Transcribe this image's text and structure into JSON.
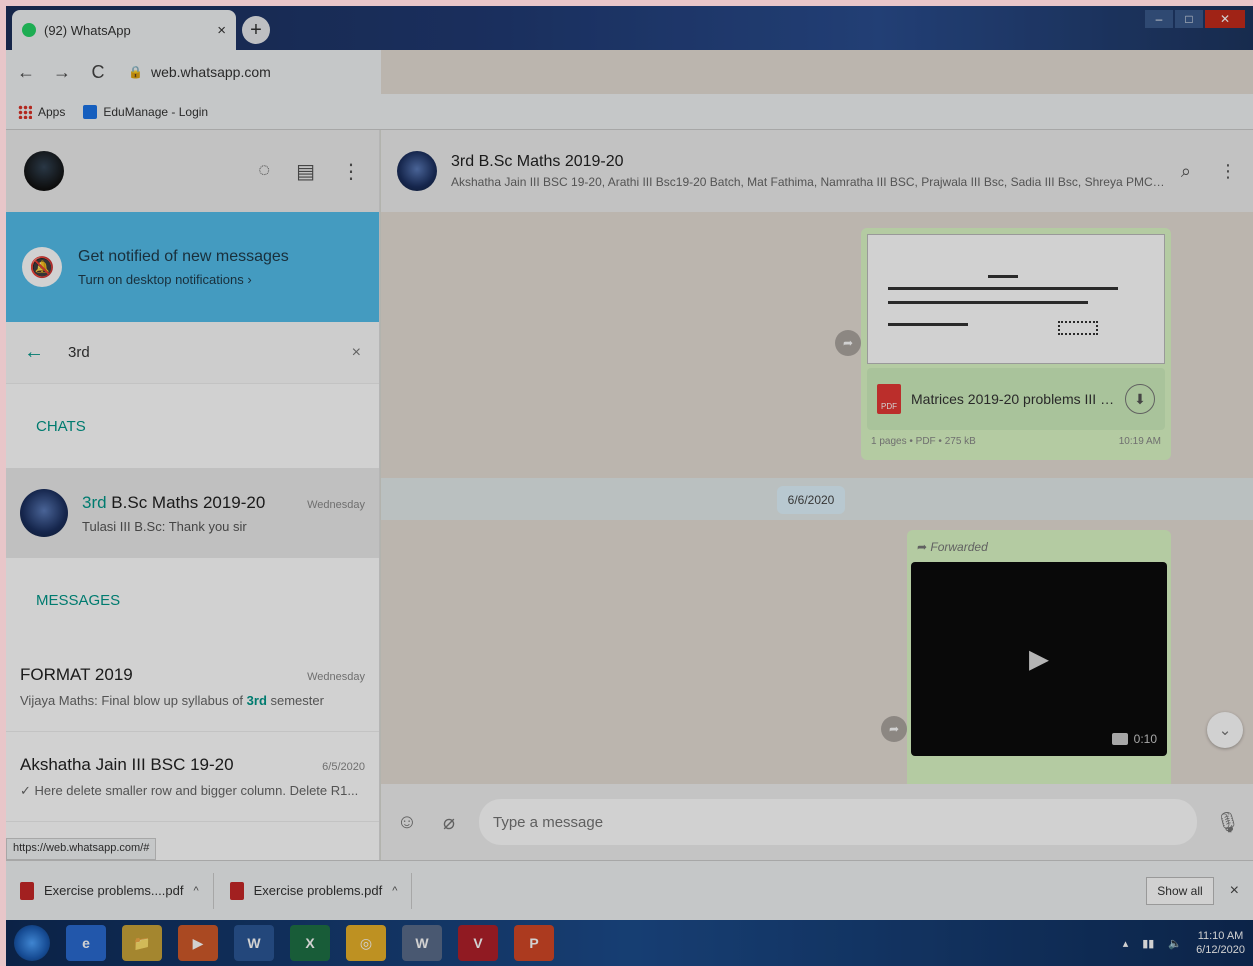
{
  "browser": {
    "tab_title": "(92) WhatsApp",
    "tab_close": "×",
    "new_tab": "+",
    "url": "web.whatsapp.com",
    "nav": {
      "back": "←",
      "forward": "→",
      "reload": "C"
    },
    "star_icon": "☆",
    "menu_icon": "⋮",
    "bookmarks": [
      {
        "label": "Apps"
      },
      {
        "label": "EduManage - Login"
      }
    ],
    "status_url": "https://web.whatsapp.com/#"
  },
  "whatsapp": {
    "left_icons": {
      "status": "◌",
      "new_chat": "▤",
      "menu": "⋮"
    },
    "notification": {
      "title": "Get notified of new messages",
      "subtitle": "Turn on desktop notifications ›"
    },
    "search": {
      "value": "3rd",
      "back": "←",
      "clear": "×"
    },
    "chats_label": "CHATS",
    "messages_label": "MESSAGES",
    "chat_result": {
      "name_highlight": "3rd",
      "name_rest": " B.Sc Maths 2019-20",
      "time": "Wednesday",
      "preview": "Tulasi III B.Sc: Thank you sir"
    },
    "message_results": [
      {
        "name": "FORMAT 2019",
        "time": "Wednesday",
        "preview_before": "Vijaya Maths: Final blow up syllabus of ",
        "preview_highlight": "3rd",
        "preview_after": " semester"
      },
      {
        "name": "Akshatha Jain III BSC 19-20",
        "time": "6/5/2020",
        "preview_before": "✓ Here delete smaller row and bigger column. Delete R1...",
        "preview_highlight": "",
        "preview_after": ""
      }
    ],
    "group": {
      "name": "3rd B.Sc Maths 2019-20",
      "members": "Akshatha Jain III BSC 19-20, Arathi III Bsc19-20 Batch, Mat Fathima, Namratha III BSC, Prajwala III Bsc, Sadia III Bsc, Shreya PMC 19-..."
    },
    "right_icons": {
      "search": "⌕",
      "menu": "⋮"
    },
    "doc_message": {
      "file_name": "Matrices 2019-20 problems III B...",
      "meta_left": "1 pages • PDF • 275 kB",
      "meta_right": "10:19 AM",
      "pdf_label": "PDF",
      "download_icon": "⬇"
    },
    "date_chip": "6/6/2020",
    "video_message": {
      "forwarded_label": "➦ Forwarded",
      "duration": "0:10",
      "play_icon": "▶"
    },
    "scroll_down_icon": "⌄",
    "composer": {
      "placeholder": "Type a message",
      "emoji_icon": "☺",
      "attach_icon": "⌀",
      "mic_icon": "🎙"
    }
  },
  "downloads": {
    "items": [
      {
        "name": "Exercise problems....pdf"
      },
      {
        "name": "Exercise problems.pdf"
      }
    ],
    "chevron": "^",
    "show_all": "Show all",
    "close": "×"
  },
  "taskbar": {
    "apps": [
      "e",
      "📁",
      "▶",
      "W",
      "X",
      "◎",
      "W",
      "V",
      "P"
    ],
    "time": "11:10 AM",
    "date": "6/12/2020"
  },
  "colors": {
    "whatsapp_teal": "#009688",
    "notification_blue": "#53bdeb",
    "outgoing_bubble": "#dcf8c6",
    "chat_background": "#e5ddd5"
  }
}
